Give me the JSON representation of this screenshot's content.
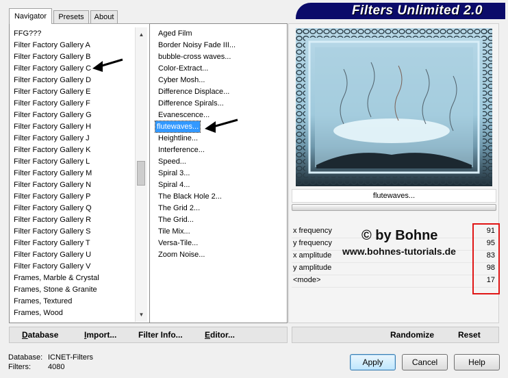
{
  "tabs": [
    {
      "label": "Navigator",
      "active": true
    },
    {
      "label": "Presets",
      "active": false
    },
    {
      "label": "About",
      "active": false
    }
  ],
  "app": {
    "title": "Filters Unlimited 2.0"
  },
  "categories": [
    "FFG???",
    "Filter Factory Gallery A",
    "Filter Factory Gallery B",
    "Filter Factory Gallery C",
    "Filter Factory Gallery D",
    "Filter Factory Gallery E",
    "Filter Factory Gallery F",
    "Filter Factory Gallery G",
    "Filter Factory Gallery H",
    "Filter Factory Gallery J",
    "Filter Factory Gallery K",
    "Filter Factory Gallery L",
    "Filter Factory Gallery M",
    "Filter Factory Gallery N",
    "Filter Factory Gallery P",
    "Filter Factory Gallery Q",
    "Filter Factory Gallery R",
    "Filter Factory Gallery S",
    "Filter Factory Gallery T",
    "Filter Factory Gallery U",
    "Filter Factory Gallery V",
    "Frames, Marble & Crystal",
    "Frames, Stone & Granite",
    "Frames, Textured",
    "Frames, Wood"
  ],
  "filters": [
    "Aged Film",
    "Border Noisy Fade III...",
    "bubble-cross waves...",
    "Color-Extract...",
    "Cyber Mosh...",
    "Difference Displace...",
    "Difference Spirals...",
    "Evanescence...",
    "flutewaves...",
    "Heightline...",
    "Interference...",
    "Speed...",
    "Spiral 3...",
    "Spiral 4...",
    "The Black Hole 2...",
    "The Grid 2...",
    "The Grid...",
    "Tile Mix...",
    "Versa-Tile...",
    "Zoom Noise..."
  ],
  "selected_filter": "flutewaves...",
  "left_buttons": [
    {
      "first": "D",
      "rest": "atabase"
    },
    {
      "first": "I",
      "rest": "mport..."
    },
    {
      "first": "Filter ",
      "rest": "Info..."
    },
    {
      "first": "E",
      "rest": "ditor..."
    }
  ],
  "preview_label": "flutewaves...",
  "params": [
    {
      "label": "x frequency",
      "value": "91"
    },
    {
      "label": "y frequency",
      "value": "95"
    },
    {
      "label": "x amplitude",
      "value": "83"
    },
    {
      "label": "y amplitude",
      "value": "98"
    },
    {
      "label": "<mode>",
      "value": "17"
    }
  ],
  "watermark": {
    "line1": "© by Bohne",
    "line2": "www.bohnes-tutorials.de"
  },
  "right_buttons": {
    "randomize": "Randomize",
    "reset": "Reset"
  },
  "status": {
    "database_label": "Database:",
    "database_value": "ICNET-Filters",
    "filters_label": "Filters:",
    "filters_value": "4080"
  },
  "dialog_buttons": {
    "apply": "Apply",
    "cancel": "Cancel",
    "help": "Help"
  },
  "colors": {
    "banner": "#0b0b6a",
    "selection": "#3399ff",
    "highlight_box": "#e01515"
  }
}
